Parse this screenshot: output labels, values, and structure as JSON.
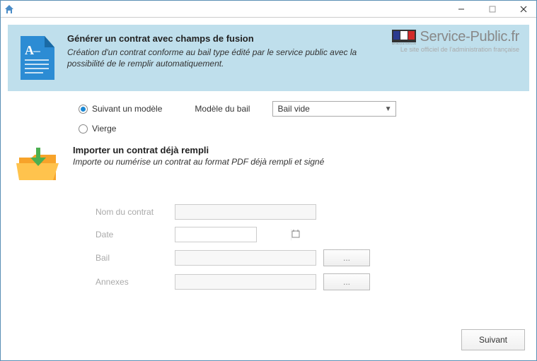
{
  "titlebar": {
    "icon": "home-icon"
  },
  "hero": {
    "title": "Générer un contrat avec champs de fusion",
    "subtitle": "Création d'un contrat conforme au bail type édité par le service public avec la possibilité de le remplir automatiquement."
  },
  "logo": {
    "text": "Service-Public",
    "suffix": ".fr",
    "tagline": "Le site officiel de l'administration française",
    "emblem": "RÉPUBLIQUE FRANÇAISE"
  },
  "options": {
    "radio_model": "Suivant un modèle",
    "radio_blank": "Vierge",
    "dropdown_label": "Modèle du bail",
    "dropdown_value": "Bail vide"
  },
  "import": {
    "title": "Importer un contrat déjà rempli",
    "subtitle": "Importe ou numérise un contrat au format PDF déjà rempli et signé"
  },
  "form": {
    "contract_name_label": "Nom du contrat",
    "contract_name_value": "",
    "date_label": "Date",
    "date_value": "",
    "bail_label": "Bail",
    "bail_value": "",
    "annexes_label": "Annexes",
    "annexes_value": "",
    "browse": "..."
  },
  "footer": {
    "next": "Suivant"
  }
}
